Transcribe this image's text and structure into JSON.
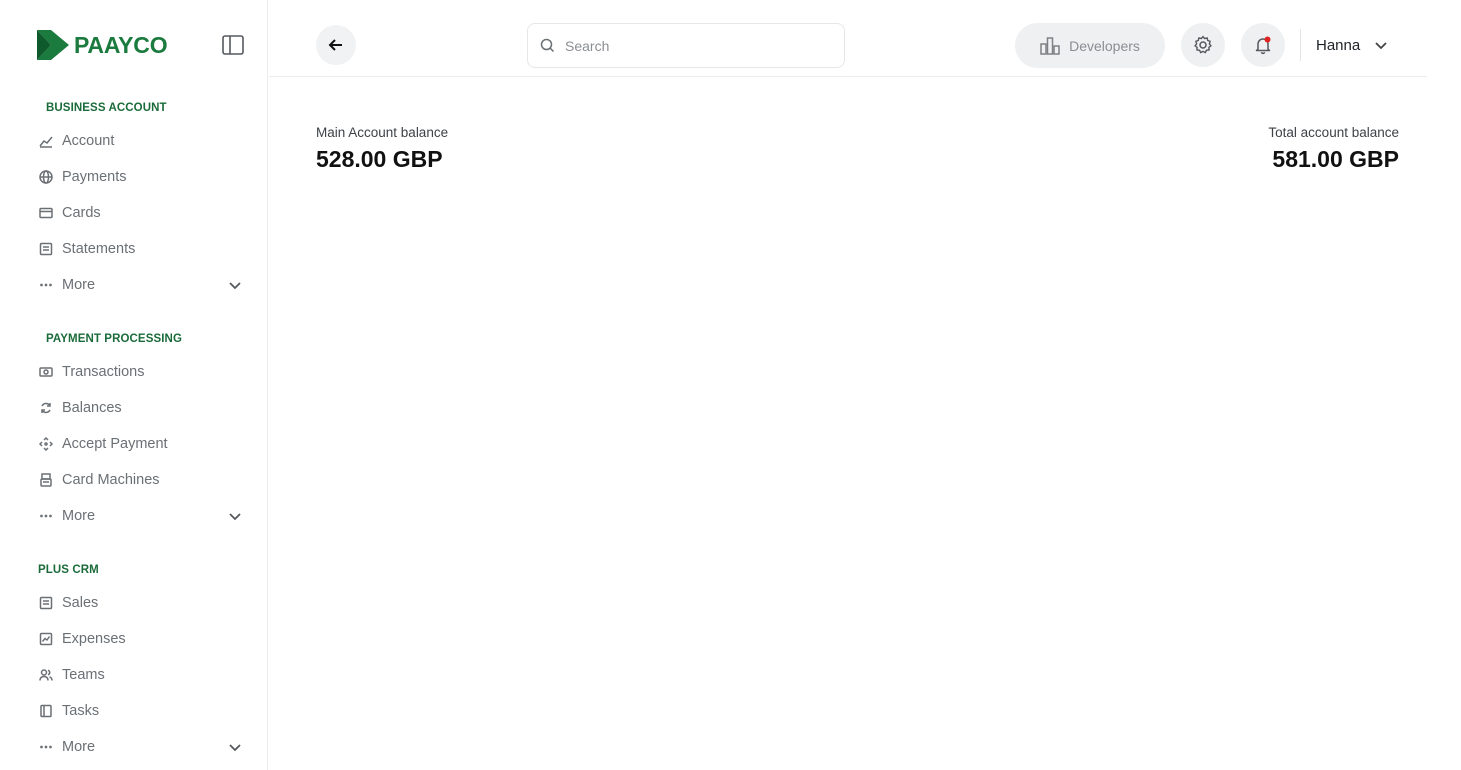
{
  "brand": {
    "name": "PAAYCO",
    "color": "#1b7a3e"
  },
  "sidebar": {
    "sections": [
      {
        "title": "BUSINESS ACCOUNT",
        "items": [
          {
            "label": "Account",
            "icon": "chart-icon"
          },
          {
            "label": "Payments",
            "icon": "globe-icon"
          },
          {
            "label": "Cards",
            "icon": "card-icon"
          },
          {
            "label": "Statements",
            "icon": "document-icon"
          },
          {
            "label": "More",
            "icon": "dots-icon"
          }
        ]
      },
      {
        "title": "PAYMENT PROCESSING",
        "items": [
          {
            "label": "Transactions",
            "icon": "cash-icon"
          },
          {
            "label": "Balances",
            "icon": "refresh-icon"
          },
          {
            "label": "Accept Payment",
            "icon": "move-icon"
          },
          {
            "label": "Card Machines",
            "icon": "terminal-icon"
          },
          {
            "label": "More",
            "icon": "dots-icon"
          }
        ]
      },
      {
        "title": "PLUS CRM",
        "items": [
          {
            "label": "Sales",
            "icon": "list-icon"
          },
          {
            "label": "Expenses",
            "icon": "trend-icon"
          },
          {
            "label": "Teams",
            "icon": "users-icon"
          },
          {
            "label": "Tasks",
            "icon": "book-icon"
          },
          {
            "label": "More",
            "icon": "dots-icon"
          }
        ]
      }
    ]
  },
  "topbar": {
    "search_placeholder": "Search",
    "developers_label": "Developers",
    "user_name": "Hanna",
    "notification_dot_color": "#e02424"
  },
  "balances": {
    "main_label": "Main Account balance",
    "main_value": "528.00 GBP",
    "total_label": "Total account balance",
    "total_value": "581.00 GBP"
  }
}
